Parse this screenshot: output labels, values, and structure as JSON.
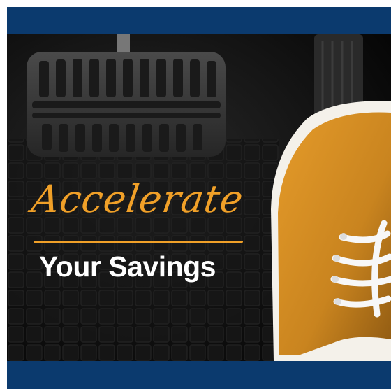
{
  "headline": {
    "script_text": "Accelerate",
    "main_text": "Your Savings"
  },
  "colors": {
    "brand_navy": "#0b3a6e",
    "accent_orange": "#f0a028",
    "shoe_orange": "#c9841f",
    "floor_dark": "#141414"
  }
}
